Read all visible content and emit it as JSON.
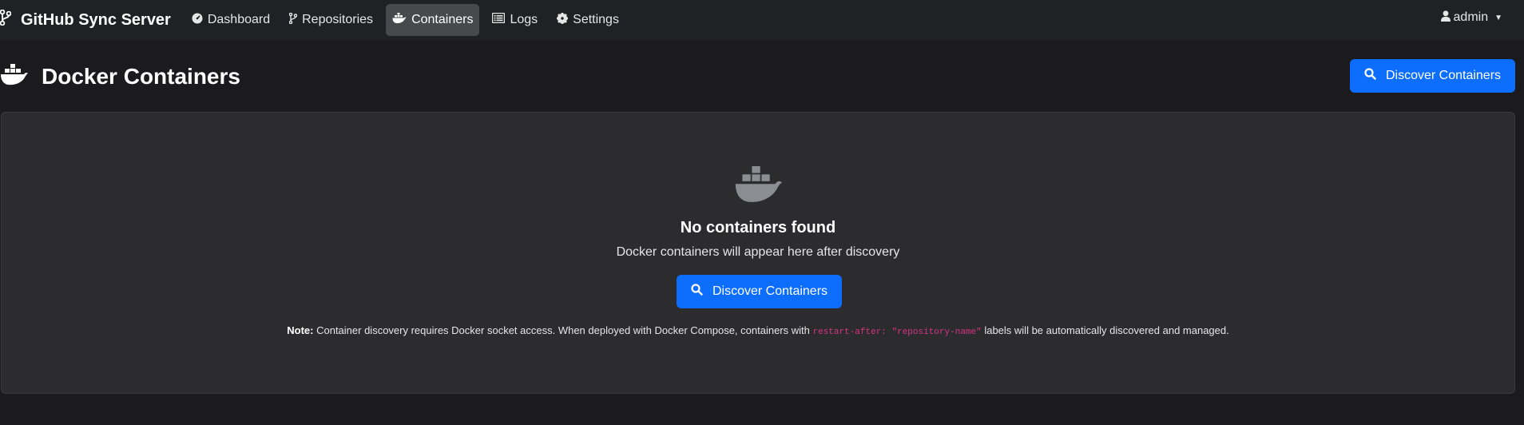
{
  "navbar": {
    "brand": "GitHub Sync Server",
    "items": [
      {
        "label": "Dashboard",
        "icon": "dashboard-icon"
      },
      {
        "label": "Repositories",
        "icon": "branch-icon"
      },
      {
        "label": "Containers",
        "icon": "docker-icon",
        "active": true
      },
      {
        "label": "Logs",
        "icon": "list-icon"
      },
      {
        "label": "Settings",
        "icon": "gear-icon"
      }
    ],
    "user": "admin"
  },
  "header": {
    "title": "Docker Containers",
    "discover_label": "Discover Containers"
  },
  "empty_state": {
    "title": "No containers found",
    "subtitle": "Docker containers will appear here after discovery",
    "button_label": "Discover Containers",
    "note_label": "Note:",
    "note_text_before": " Container discovery requires Docker socket access. When deployed with Docker Compose, containers with ",
    "note_code": "restart-after: \"repository-name\"",
    "note_text_after": " labels will be automatically discovered and managed."
  },
  "colors": {
    "primary": "#0d6efd",
    "background": "#1b1b1d",
    "navbar": "#202124",
    "card": "#2c2c2e",
    "code": "#d63384"
  }
}
